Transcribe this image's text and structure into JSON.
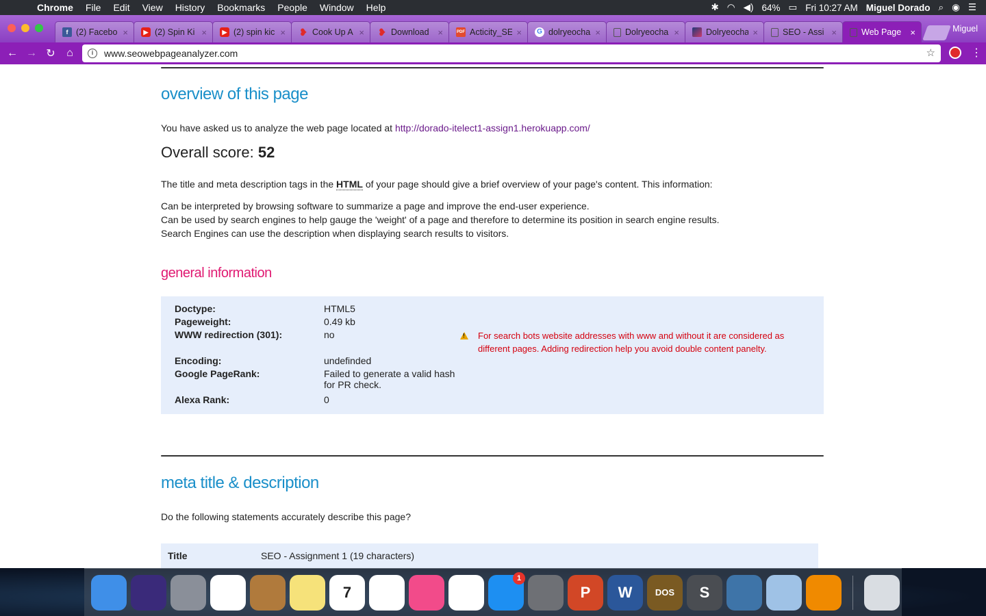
{
  "menubar": {
    "app": "Chrome",
    "items": [
      "File",
      "Edit",
      "View",
      "History",
      "Bookmarks",
      "People",
      "Window",
      "Help"
    ],
    "battery": "64%",
    "clock": "Fri 10:27 AM",
    "user": "Miguel Dorado"
  },
  "tabs": [
    {
      "label": "(2) Facebo",
      "icon": "facebook-icon"
    },
    {
      "label": "(2) Spin Ki",
      "icon": "youtube-icon"
    },
    {
      "label": "(2) spin kic",
      "icon": "youtube-icon"
    },
    {
      "label": "Cook Up A",
      "icon": "heart-icon"
    },
    {
      "label": "Download",
      "icon": "heart-icon"
    },
    {
      "label": "Acticity_SE",
      "icon": "pdf-icon"
    },
    {
      "label": "dolryeocha",
      "icon": "google-icon"
    },
    {
      "label": "Dolryeocha",
      "icon": "document-icon"
    },
    {
      "label": "Dolryeocha",
      "icon": "image-icon"
    },
    {
      "label": "SEO - Assi",
      "icon": "document-icon"
    },
    {
      "label": "Web Page",
      "icon": "document-icon",
      "active": true
    }
  ],
  "profile_name": "Miguel",
  "address_bar": {
    "url": "www.seowebpageanalyzer.com"
  },
  "page": {
    "overview_heading": "overview of this page",
    "asked_text": "You have asked us to analyze the web page located at ",
    "analyzed_url": "http://dorado-itelect1-assign1.herokuapp.com/",
    "score_label": "Overall score: ",
    "score_value": "52",
    "intro_before": "The title and meta description tags in the ",
    "intro_abbr": "HTML",
    "intro_after": " of your page should give a brief overview of your page's content. This information:",
    "bullets": [
      "Can be interpreted by browsing software to summarize a page and improve the end-user experience.",
      "Can be used by search engines to help gauge the 'weight' of a page and therefore to determine its position in search engine results.",
      "Search Engines can use the description when displaying search results to visitors."
    ],
    "general_heading": "general information",
    "general_rows": [
      {
        "key": "Doctype:",
        "value": "HTML5"
      },
      {
        "key": "Pageweight:",
        "value": "0.49 kb"
      },
      {
        "key": "WWW redirection (301):",
        "value": "no"
      },
      {
        "key": "Encoding:",
        "value": "undefinded"
      },
      {
        "key": "Google PageRank:",
        "value": "Failed to generate a valid hash for PR check."
      },
      {
        "key": "Alexa Rank:",
        "value": "0"
      }
    ],
    "www_warning": "For search bots website addresses with www and without it are considered as different pages. Adding redirection help you avoid double content panelty.",
    "meta_heading": "meta title & description",
    "meta_question": "Do the following statements accurately describe this page?",
    "meta_title_key": "Title",
    "meta_title_value": "SEO - Assignment 1 (19 characters)"
  },
  "dock": [
    {
      "name": "finder-icon",
      "color": "#3f8fe8"
    },
    {
      "name": "siri-icon",
      "color": "#3a2a7a"
    },
    {
      "name": "launchpad-icon",
      "color": "#8a8f99"
    },
    {
      "name": "chrome-icon",
      "color": "#ffffff"
    },
    {
      "name": "contacts-icon",
      "color": "#b07a3c"
    },
    {
      "name": "notes-icon",
      "color": "#f6e27a"
    },
    {
      "name": "calendar-icon",
      "color": "#ffffff",
      "label": "7"
    },
    {
      "name": "photos-icon",
      "color": "#ffffff"
    },
    {
      "name": "itunes-icon",
      "color": "#f24b8a"
    },
    {
      "name": "reminders-icon",
      "color": "#ffffff"
    },
    {
      "name": "app-store-icon",
      "color": "#1d8ff2",
      "badge": "1"
    },
    {
      "name": "system-preferences-icon",
      "color": "#6e7075"
    },
    {
      "name": "powerpoint-icon",
      "color": "#d24726",
      "label": "P"
    },
    {
      "name": "word-icon",
      "color": "#2b579a",
      "label": "W"
    },
    {
      "name": "dosbox-icon",
      "color": "#7a5a22",
      "label": "DOS"
    },
    {
      "name": "sublime-text-icon",
      "color": "#4a4d52",
      "label": "S"
    },
    {
      "name": "python-icon",
      "color": "#3e74a8"
    },
    {
      "name": "virtualbox-icon",
      "color": "#9fc2e6"
    },
    {
      "name": "vlc-icon",
      "color": "#f08a00"
    },
    {
      "name": "trash-icon",
      "color": "#d9dde2"
    }
  ]
}
